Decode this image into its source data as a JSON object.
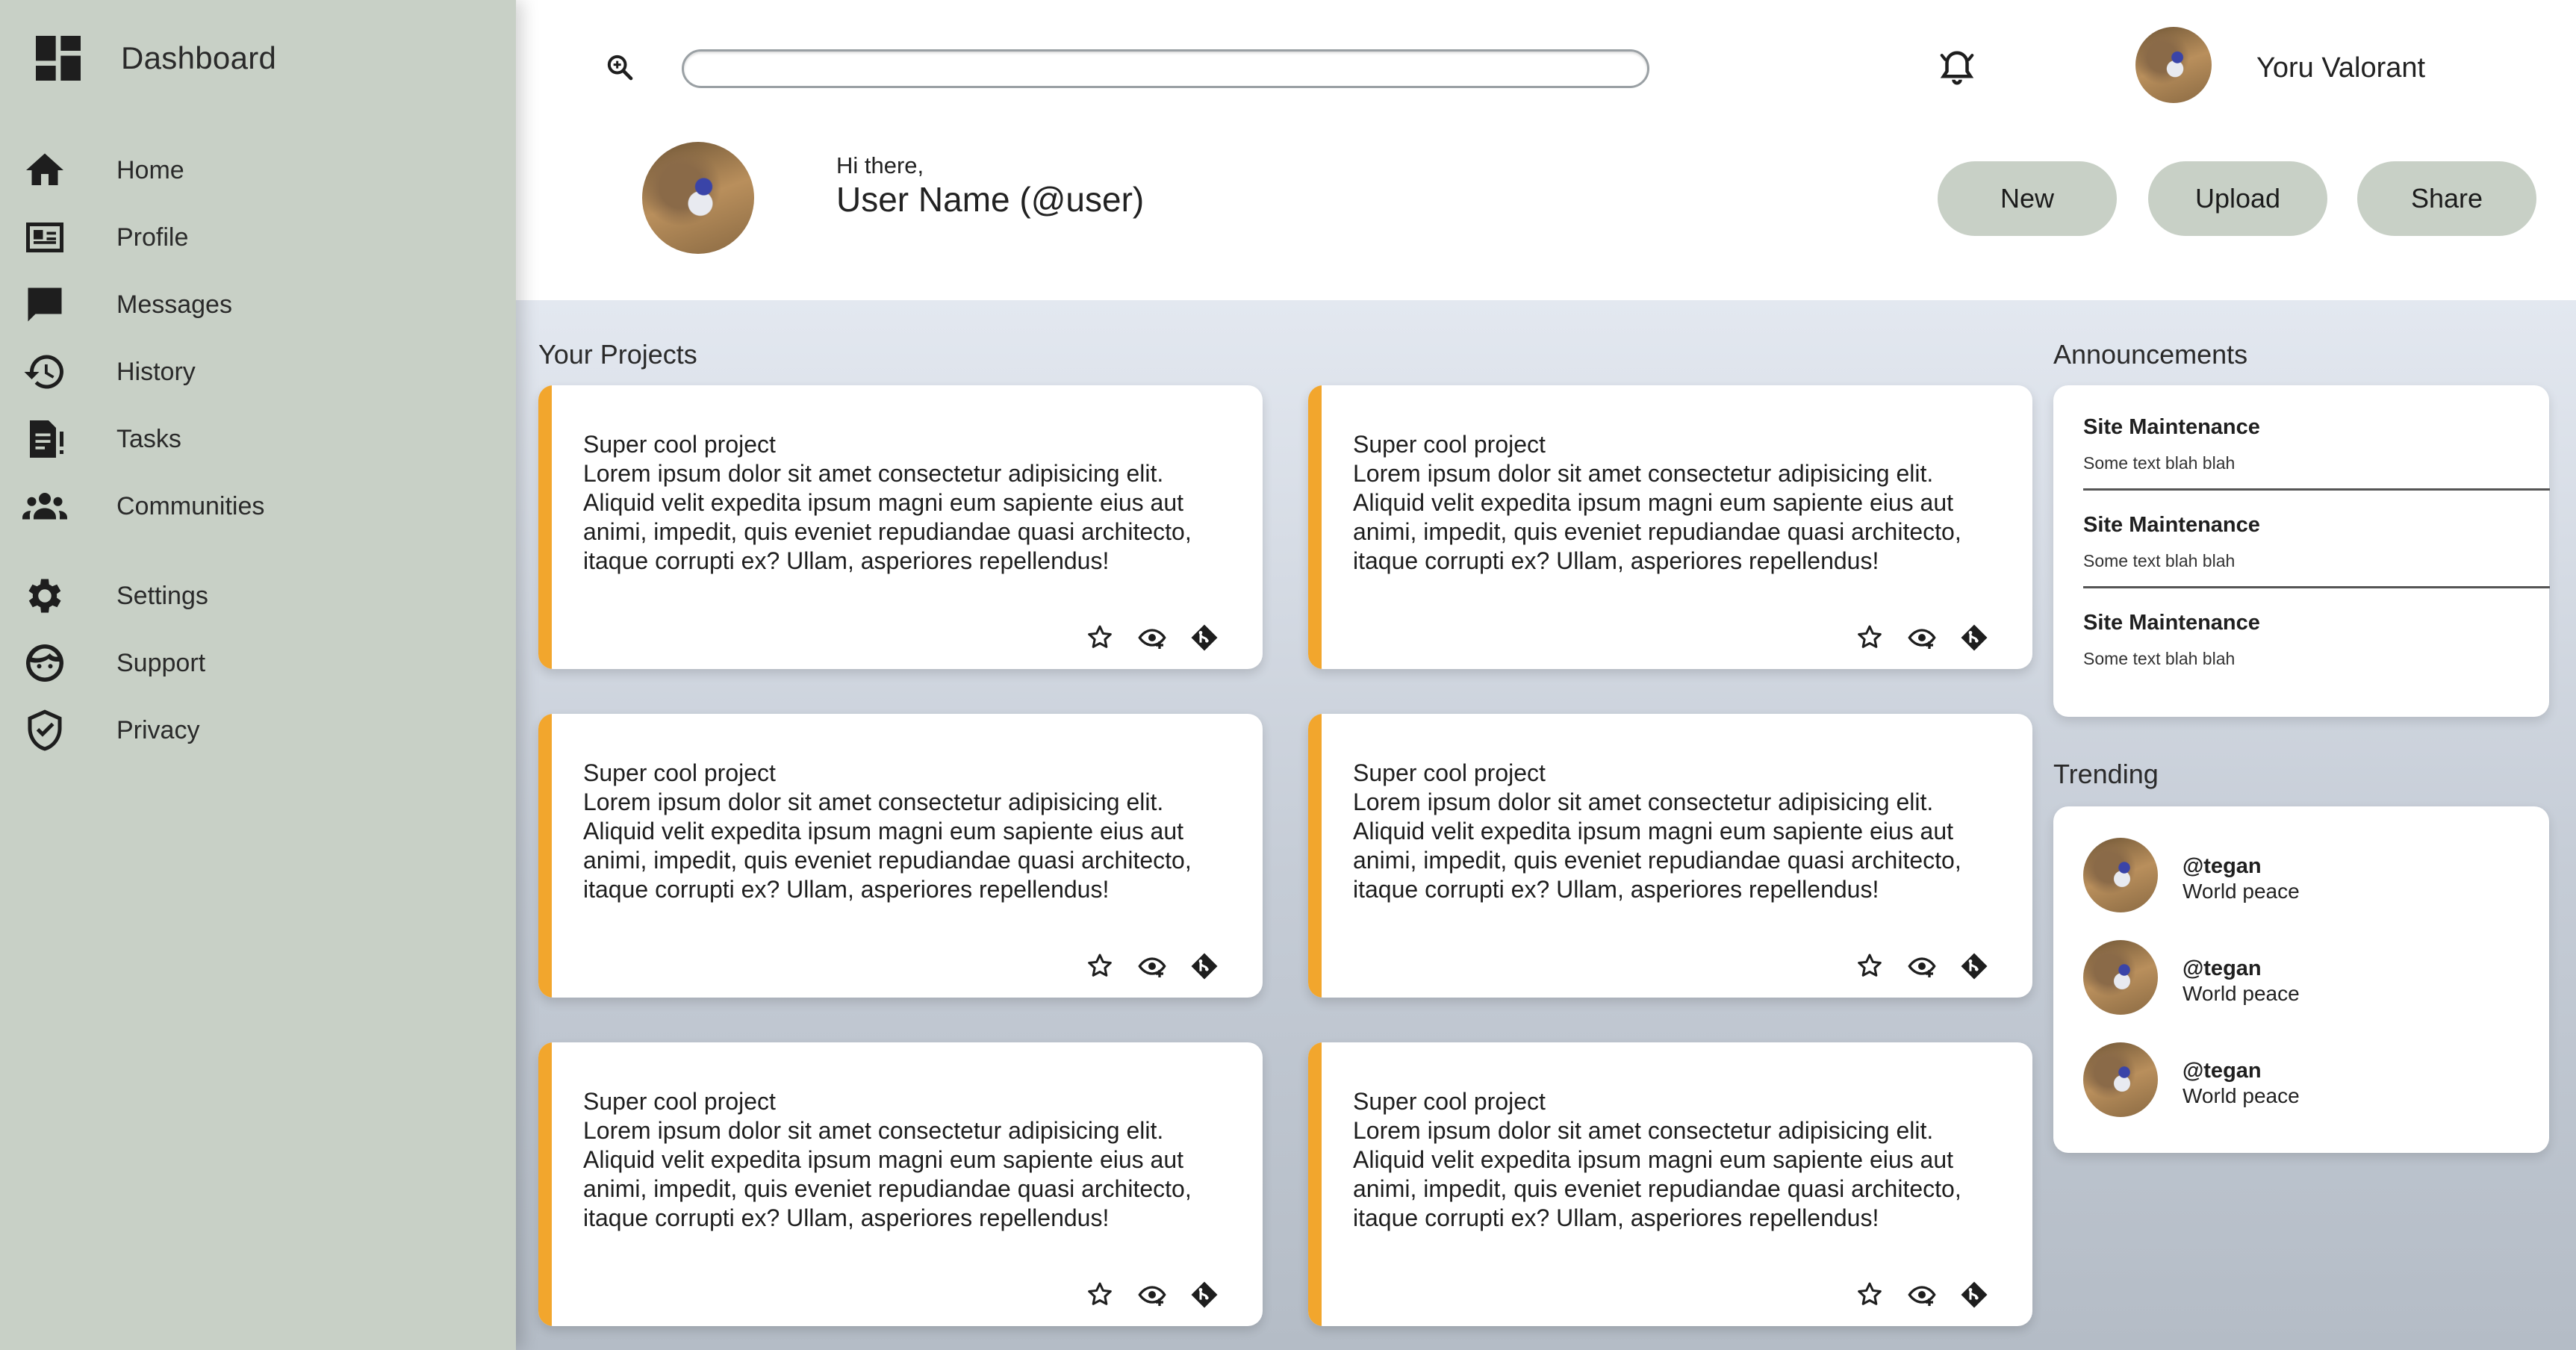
{
  "sidebar": {
    "title": "Dashboard",
    "items": [
      {
        "label": "Home",
        "icon": "home-icon"
      },
      {
        "label": "Profile",
        "icon": "id-card-icon"
      },
      {
        "label": "Messages",
        "icon": "chat-icon"
      },
      {
        "label": "History",
        "icon": "history-icon"
      },
      {
        "label": "Tasks",
        "icon": "tasks-icon"
      },
      {
        "label": "Communities",
        "icon": "group-icon"
      },
      {
        "label": "Settings",
        "icon": "gear-icon"
      },
      {
        "label": "Support",
        "icon": "support-icon"
      },
      {
        "label": "Privacy",
        "icon": "shield-icon"
      }
    ]
  },
  "header": {
    "search_value": "",
    "user_name": "Yoru Valorant",
    "greeting": "Hi there,",
    "handle": "User Name (@user)",
    "buttons": {
      "new": "New",
      "upload": "Upload",
      "share": "Share"
    }
  },
  "projects": {
    "title": "Your Projects",
    "cards": [
      {
        "title": "Super cool project",
        "body": "Lorem ipsum dolor sit amet consectetur adipisicing elit. Aliquid velit expedita ipsum magni eum sapiente eius aut animi, impedit, quis eveniet repudiandae quasi architecto, itaque corrupti ex? Ullam, asperiores repellendus!"
      },
      {
        "title": "Super cool project",
        "body": "Lorem ipsum dolor sit amet consectetur adipisicing elit. Aliquid velit expedita ipsum magni eum sapiente eius aut animi, impedit, quis eveniet repudiandae quasi architecto, itaque corrupti ex? Ullam, asperiores repellendus!"
      },
      {
        "title": "Super cool project",
        "body": "Lorem ipsum dolor sit amet consectetur adipisicing elit. Aliquid velit expedita ipsum magni eum sapiente eius aut animi, impedit, quis eveniet repudiandae quasi architecto, itaque corrupti ex? Ullam, asperiores repellendus!"
      },
      {
        "title": "Super cool project",
        "body": "Lorem ipsum dolor sit amet consectetur adipisicing elit. Aliquid velit expedita ipsum magni eum sapiente eius aut animi, impedit, quis eveniet repudiandae quasi architecto, itaque corrupti ex? Ullam, asperiores repellendus!"
      },
      {
        "title": "Super cool project",
        "body": "Lorem ipsum dolor sit amet consectetur adipisicing elit. Aliquid velit expedita ipsum magni eum sapiente eius aut animi, impedit, quis eveniet repudiandae quasi architecto, itaque corrupti ex? Ullam, asperiores repellendus!"
      },
      {
        "title": "Super cool project",
        "body": "Lorem ipsum dolor sit amet consectetur adipisicing elit. Aliquid velit expedita ipsum magni eum sapiente eius aut animi, impedit, quis eveniet repudiandae quasi architecto, itaque corrupti ex? Ullam, asperiores repellendus!"
      }
    ],
    "card_icons": [
      "star-icon",
      "watch-icon",
      "fork-icon"
    ]
  },
  "announcements": {
    "title": "Announcements",
    "items": [
      {
        "title": "Site Maintenance",
        "text": "Some text blah blah"
      },
      {
        "title": "Site Maintenance",
        "text": "Some text blah blah"
      },
      {
        "title": "Site Maintenance",
        "text": "Some text blah blah"
      }
    ]
  },
  "trending": {
    "title": "Trending",
    "items": [
      {
        "handle": "@tegan",
        "text": "World peace"
      },
      {
        "handle": "@tegan",
        "text": "World peace"
      },
      {
        "handle": "@tegan",
        "text": "World peace"
      }
    ]
  },
  "colors": {
    "sidebar_bg": "#c8d0c6",
    "accent": "#f2a62d",
    "button_bg": "#c8d0c6"
  }
}
